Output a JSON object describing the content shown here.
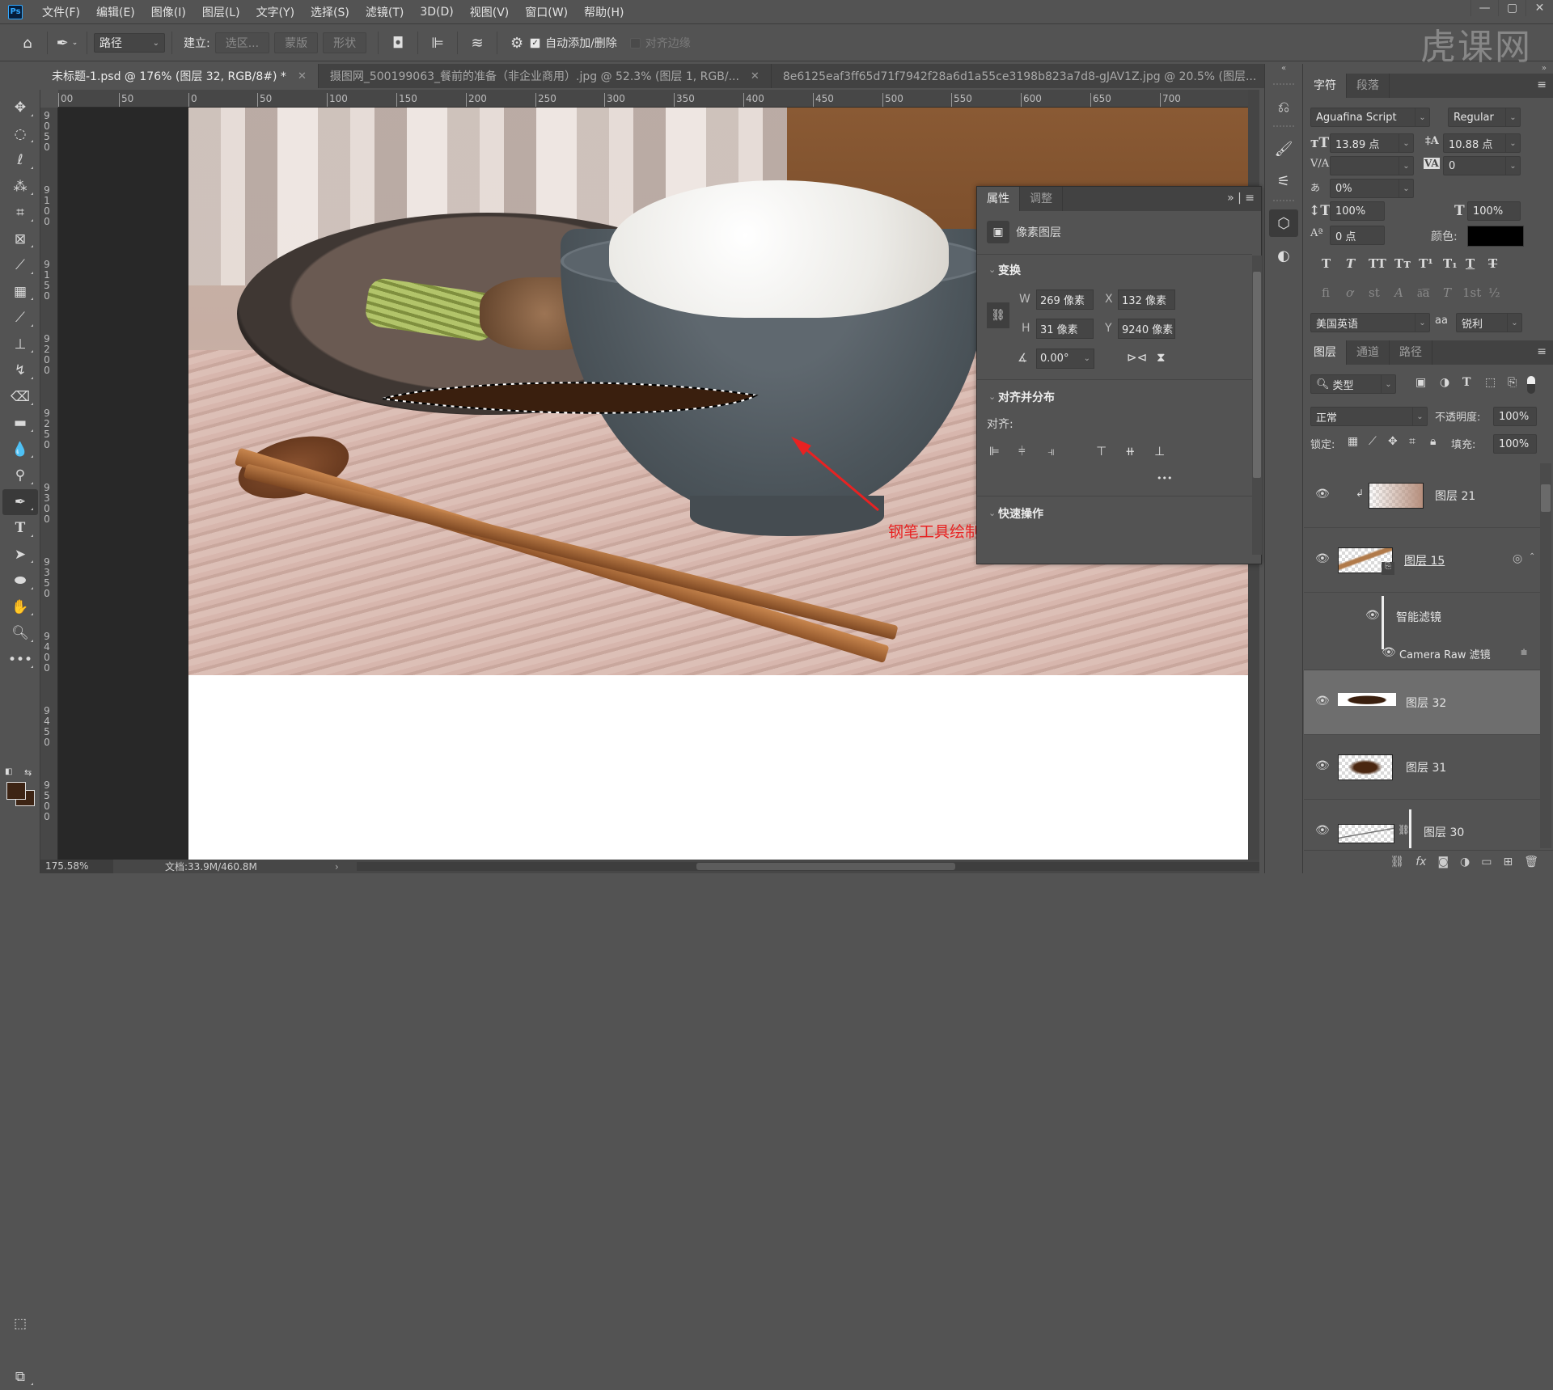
{
  "app": {
    "logo": "Ps",
    "accent": "#31a8ff"
  },
  "menu": [
    "文件(F)",
    "编辑(E)",
    "图像(I)",
    "图层(L)",
    "文字(Y)",
    "选择(S)",
    "滤镜(T)",
    "3D(D)",
    "视图(V)",
    "窗口(W)",
    "帮助(H)"
  ],
  "window_controls": {
    "minimize": "—",
    "maximize": "▢",
    "close": "✕"
  },
  "watermark": "虎课网",
  "options": {
    "tool_mode": "路径",
    "make_label": "建立:",
    "selection_btn": "选区...",
    "mask_btn": "蒙版",
    "shape_btn": "形状",
    "auto_add_delete": "自动添加/删除",
    "auto_add_delete_checked": true,
    "align_edges": "对齐边缘",
    "align_edges_checked": false
  },
  "tabs": [
    {
      "label": "未标题-1.psd @ 176% (图层 32, RGB/8#) *",
      "active": true
    },
    {
      "label": "摄图网_500199063_餐前的准备（非企业商用）.jpg @ 52.3% (图层 1, RGB/...",
      "active": false
    },
    {
      "label": "8e6125eaf3ff65d71f7942f28a6d1a55ce3198b823a7d8-gJAV1Z.jpg @ 20.5% (图层...",
      "active": false
    }
  ],
  "ruler": {
    "top": [
      "00",
      "50",
      "0",
      "50",
      "100",
      "150",
      "200",
      "250",
      "300",
      "350",
      "400",
      "450",
      "500",
      "550",
      "600",
      "650",
      "700"
    ],
    "left": [
      "9050",
      "9100",
      "9150",
      "9200",
      "9250",
      "9300",
      "9350",
      "9400",
      "9450",
      "9500"
    ]
  },
  "tools": [
    "move",
    "marquee",
    "lasso",
    "magic-wand",
    "crop",
    "frame",
    "eyedropper",
    "patch",
    "brush",
    "stamp",
    "history-brush",
    "eraser",
    "gradient",
    "blur",
    "dodge",
    "pen",
    "type",
    "path-select",
    "ellipse",
    "hand",
    "zoom",
    "more"
  ],
  "active_tool": "pen",
  "colors": {
    "foreground": "#3d2414",
    "background": "#3d2414"
  },
  "canvas": {
    "annotation": "钢笔工具绘制形状",
    "annotation_color": "#e82222",
    "shape_fill": "#3a1f0e"
  },
  "status": {
    "zoom": "175.58%",
    "doc": "文档:33.9M/460.8M",
    "arrow": "›"
  },
  "properties": {
    "tabs": [
      "属性",
      "调整"
    ],
    "layer_type": "像素图层",
    "transform_title": "变换",
    "w_label": "W",
    "w": "269 像素",
    "h_label": "H",
    "h": "31 像素",
    "x_label": "X",
    "x": "132 像素",
    "y_label": "Y",
    "y": "9240 像素",
    "angle": "0.00°",
    "align_title": "对齐并分布",
    "align_label": "对齐:",
    "more": "•••",
    "quick_title": "快速操作"
  },
  "character": {
    "tabs": [
      "字符",
      "段落"
    ],
    "font_family": "Aguafina Script",
    "font_style": "Regular",
    "size": "13.89 点",
    "leading": "10.88 点",
    "kerning": "",
    "tracking": "0",
    "tsume": "0%",
    "vscale": "100%",
    "hscale": "100%",
    "baseline": "0 点",
    "color_label": "颜色:",
    "color": "#000000",
    "language": "美国英语",
    "aa_label": "aa",
    "antialias": "锐利",
    "style_glyphs": [
      "T",
      "T",
      "TT",
      "Tт",
      "T¹",
      "T₁",
      "T",
      "T"
    ],
    "opentype_glyphs": [
      "fi",
      "ơ",
      "st",
      "A",
      "ā͞a",
      "T",
      "1st",
      "½"
    ]
  },
  "layers": {
    "tabs": [
      "图层",
      "通道",
      "路径"
    ],
    "filter": "类型",
    "blend": "正常",
    "opacity_label": "不透明度:",
    "opacity": "100%",
    "lock_label": "锁定:",
    "fill_label": "填充:",
    "fill": "100%",
    "items": [
      {
        "name": "图层 21",
        "visible": true,
        "clipped": true
      },
      {
        "name": "图层 15",
        "visible": true,
        "smart": true
      },
      {
        "name": "智能滤镜",
        "visible": true,
        "sub": true
      },
      {
        "name": "Camera Raw 滤镜",
        "visible": true,
        "sub": true
      },
      {
        "name": "图层 32",
        "visible": true,
        "selected": true
      },
      {
        "name": "图层 31",
        "visible": true
      },
      {
        "name": "图层 30",
        "visible": true,
        "linked": true
      }
    ]
  }
}
